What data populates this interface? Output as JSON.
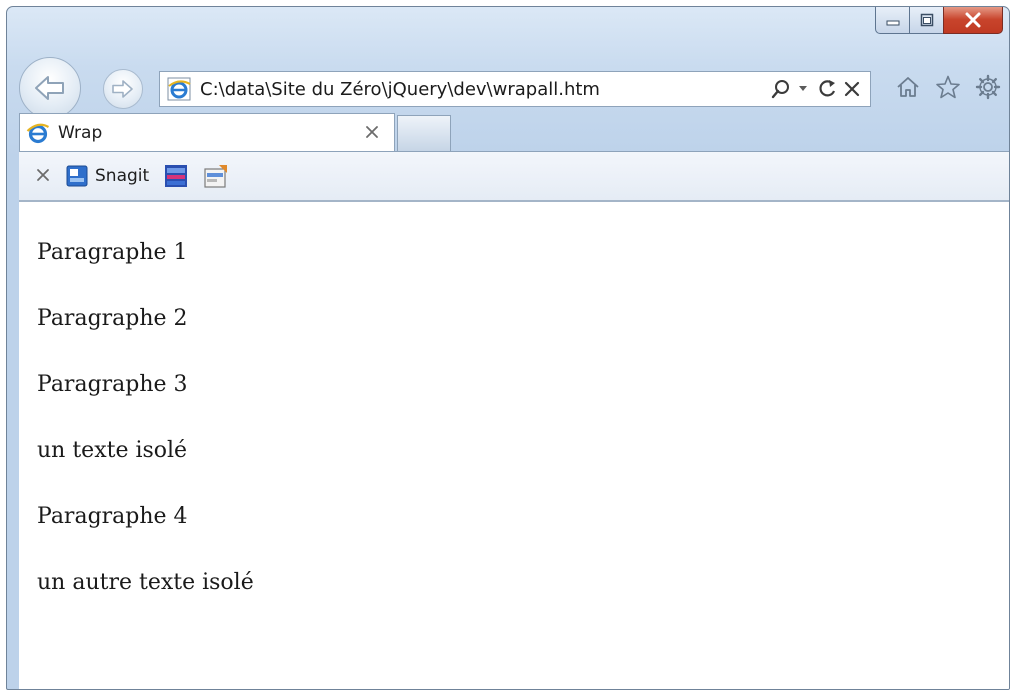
{
  "window": {
    "caption_buttons": [
      "minimize",
      "maximize",
      "close"
    ]
  },
  "navigation": {
    "back_icon": "back-arrow-icon",
    "forward_icon": "forward-arrow-icon",
    "address": "C:\\data\\Site du Zéro\\jQuery\\dev\\wrapall.htm",
    "tools": {
      "search_icon": "search-icon",
      "dropdown_icon": "chevron-down-icon",
      "refresh_icon": "refresh-icon",
      "stop_icon": "close-icon"
    },
    "right_icons": [
      "home-icon",
      "star-icon",
      "gear-icon"
    ]
  },
  "tabs": [
    {
      "title": "Wrap",
      "close_icon": "close-icon"
    }
  ],
  "favorites_bar": {
    "close_icon": "close-icon",
    "items": [
      {
        "label": "Snagit",
        "icon": "snagit-icon"
      },
      {
        "label": "",
        "icon": "snagit-editor-icon"
      },
      {
        "label": "",
        "icon": "snagit-capture-icon"
      }
    ]
  },
  "page": {
    "lines": [
      "Paragraphe 1",
      "Paragraphe 2",
      "Paragraphe 3",
      "un texte isolé",
      "Paragraphe 4",
      "un autre texte isolé"
    ]
  },
  "colors": {
    "frame": "#bdd2ea",
    "close_button": "#c8442c",
    "content_background": "#ffffff"
  }
}
